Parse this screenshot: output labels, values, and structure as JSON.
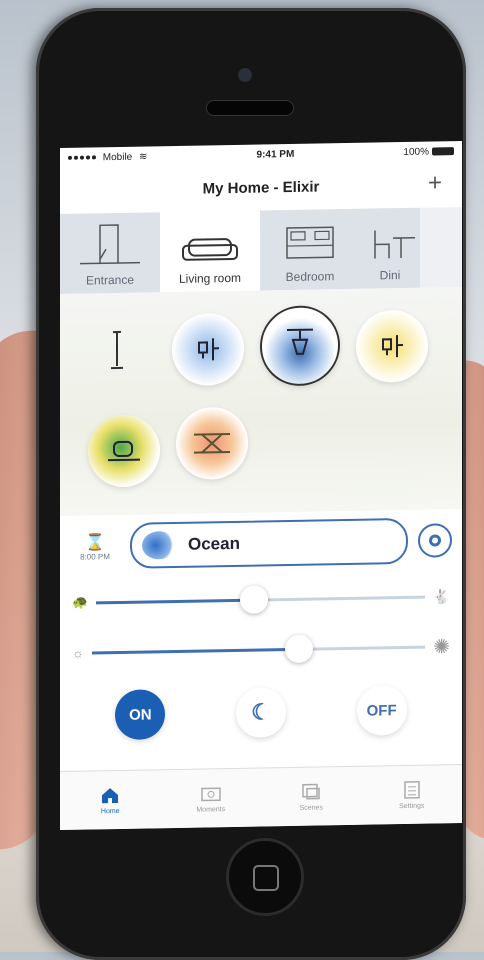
{
  "status": {
    "carrier": "Mobile",
    "time": "9:41 PM",
    "battery": "100%"
  },
  "header": {
    "title": "My Home - Elixir",
    "add_label": "+"
  },
  "rooms": [
    {
      "label": "Entrance",
      "icon": "entrance-icon"
    },
    {
      "label": "Living room",
      "icon": "sofa-icon"
    },
    {
      "label": "Bedroom",
      "icon": "bed-icon"
    },
    {
      "label": "Dini",
      "icon": "dining-icon"
    }
  ],
  "lights": [
    {
      "icon": "floor-lamp-icon",
      "state": "off"
    },
    {
      "icon": "desk-lamp-icon",
      "state": "blue"
    },
    {
      "icon": "pendant-lamp-icon",
      "state": "selected-blue"
    },
    {
      "icon": "desk-lamp-icon",
      "state": "yellow"
    },
    {
      "icon": "table-lamp-icon",
      "state": "green"
    },
    {
      "icon": "light-strip-icon",
      "state": "orange"
    }
  ],
  "scene": {
    "timer_label": "8:00 PM",
    "name": "Ocean"
  },
  "sliders": {
    "speed_level": 0.48,
    "brightness_level": 0.62
  },
  "buttons": {
    "on": "ON",
    "off": "OFF"
  },
  "tabs": [
    {
      "label": "Home",
      "icon": "home-icon"
    },
    {
      "label": "Moments",
      "icon": "camera-icon"
    },
    {
      "label": "Scenes",
      "icon": "scenes-icon"
    },
    {
      "label": "Settings",
      "icon": "settings-icon"
    }
  ],
  "colors": {
    "accent": "#1a5fb4",
    "border": "#3f6fb0"
  }
}
